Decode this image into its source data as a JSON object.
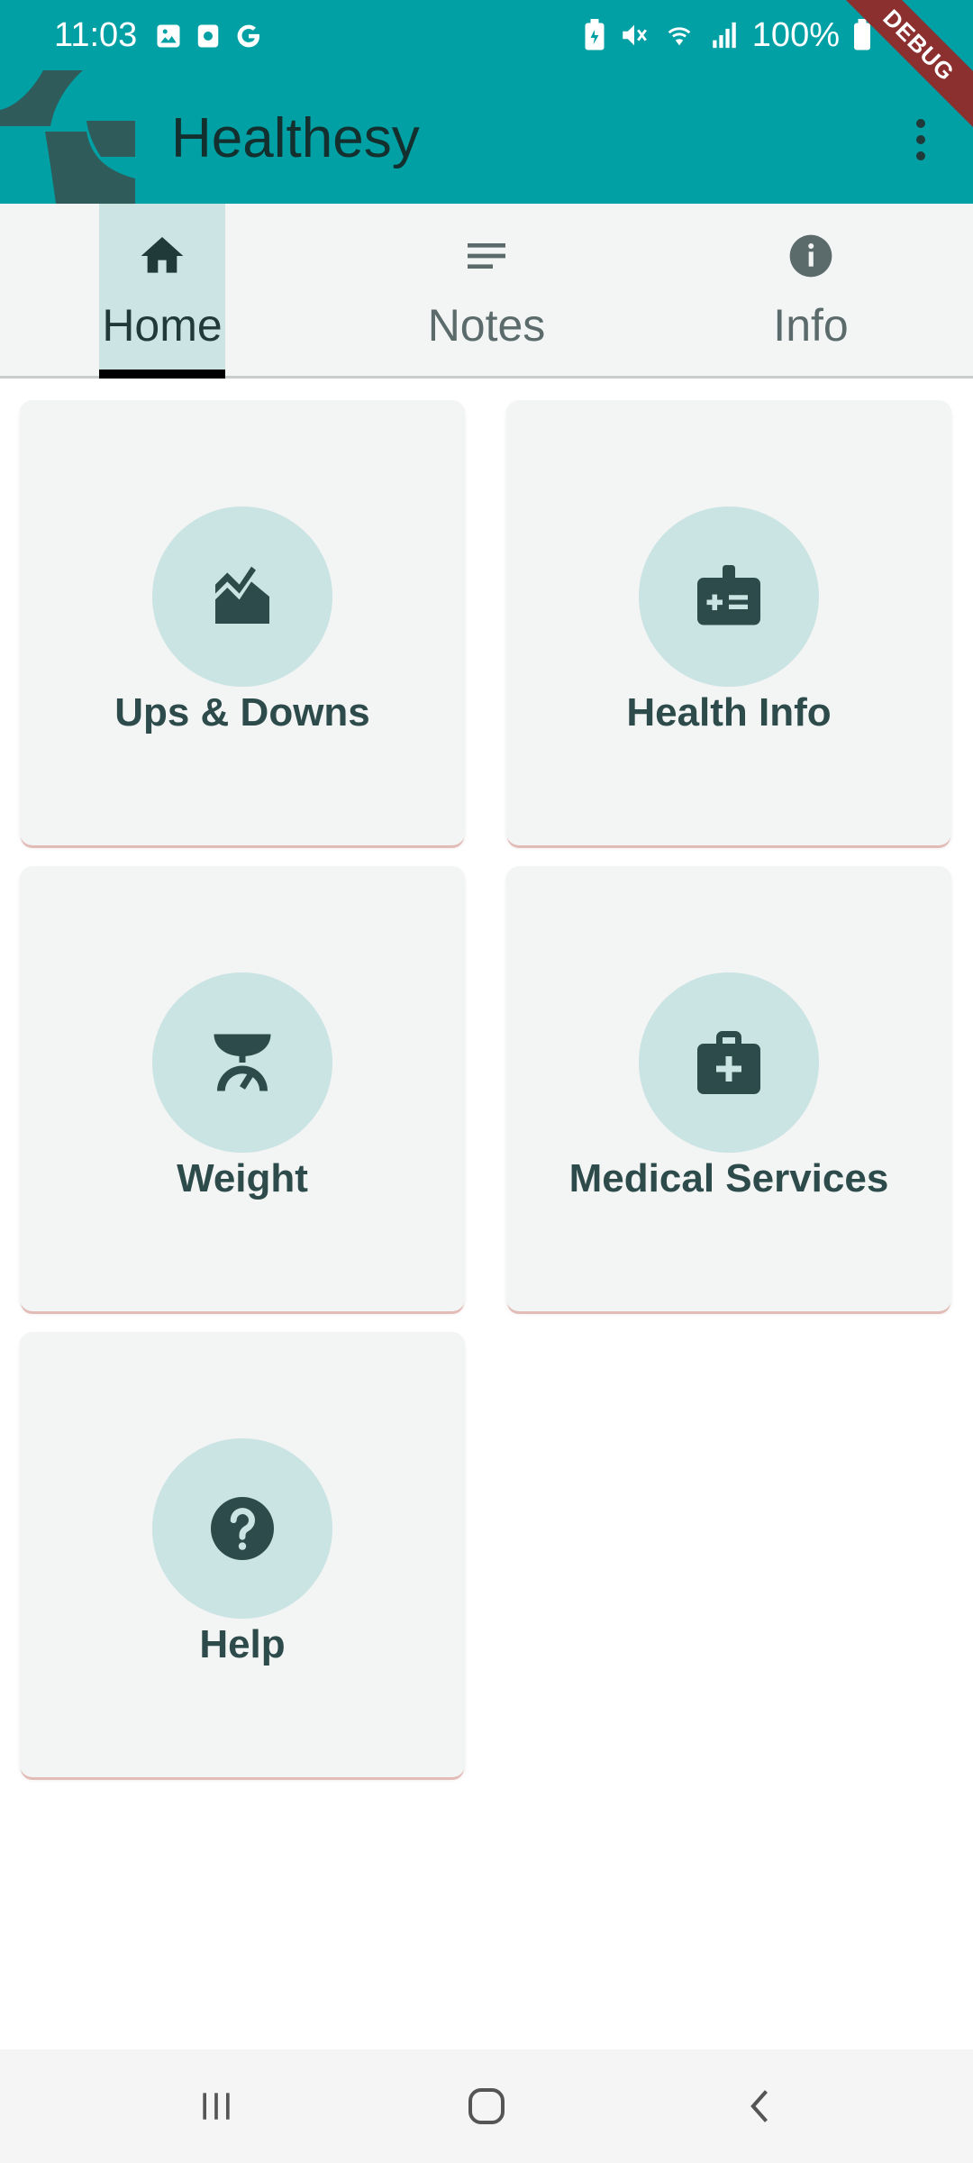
{
  "status_bar": {
    "time": "11:03",
    "battery": "100%",
    "left_icons": [
      "image-icon",
      "screen-record-icon",
      "google-g-icon"
    ],
    "right_icons": [
      "battery-saver-icon",
      "mute-icon",
      "wifi-icon",
      "signal-icon",
      "battery-icon"
    ]
  },
  "debug_banner": "DEBUG",
  "app_bar": {
    "title": "Healthesy",
    "logo_icon": "healthesy-logo",
    "menu_icon": "more-vert-icon"
  },
  "tabs": [
    {
      "label": "Home",
      "icon": "home-icon",
      "selected": true
    },
    {
      "label": "Notes",
      "icon": "notes-icon",
      "selected": false
    },
    {
      "label": "Info",
      "icon": "info-icon",
      "selected": false
    }
  ],
  "cards": [
    {
      "label": "Ups & Downs",
      "icon": "chart-icon"
    },
    {
      "label": "Health Info",
      "icon": "medical-id-icon"
    },
    {
      "label": "Weight",
      "icon": "scale-icon"
    },
    {
      "label": "Medical Services",
      "icon": "medical-kit-icon"
    },
    {
      "label": "Help",
      "icon": "help-icon"
    }
  ],
  "nav_bar": {
    "buttons": [
      "recents-icon",
      "home-icon",
      "back-icon"
    ]
  },
  "colors": {
    "app_bar": "#00A0A4",
    "tab_bar": "#F3F5F5",
    "tab_selected": "#CCE4E4",
    "card": "#F3F4F4",
    "icon_circle": "#CAE3E3",
    "icon_dark": "#2E4B4B",
    "debug_ribbon": "#8B2F2F"
  }
}
